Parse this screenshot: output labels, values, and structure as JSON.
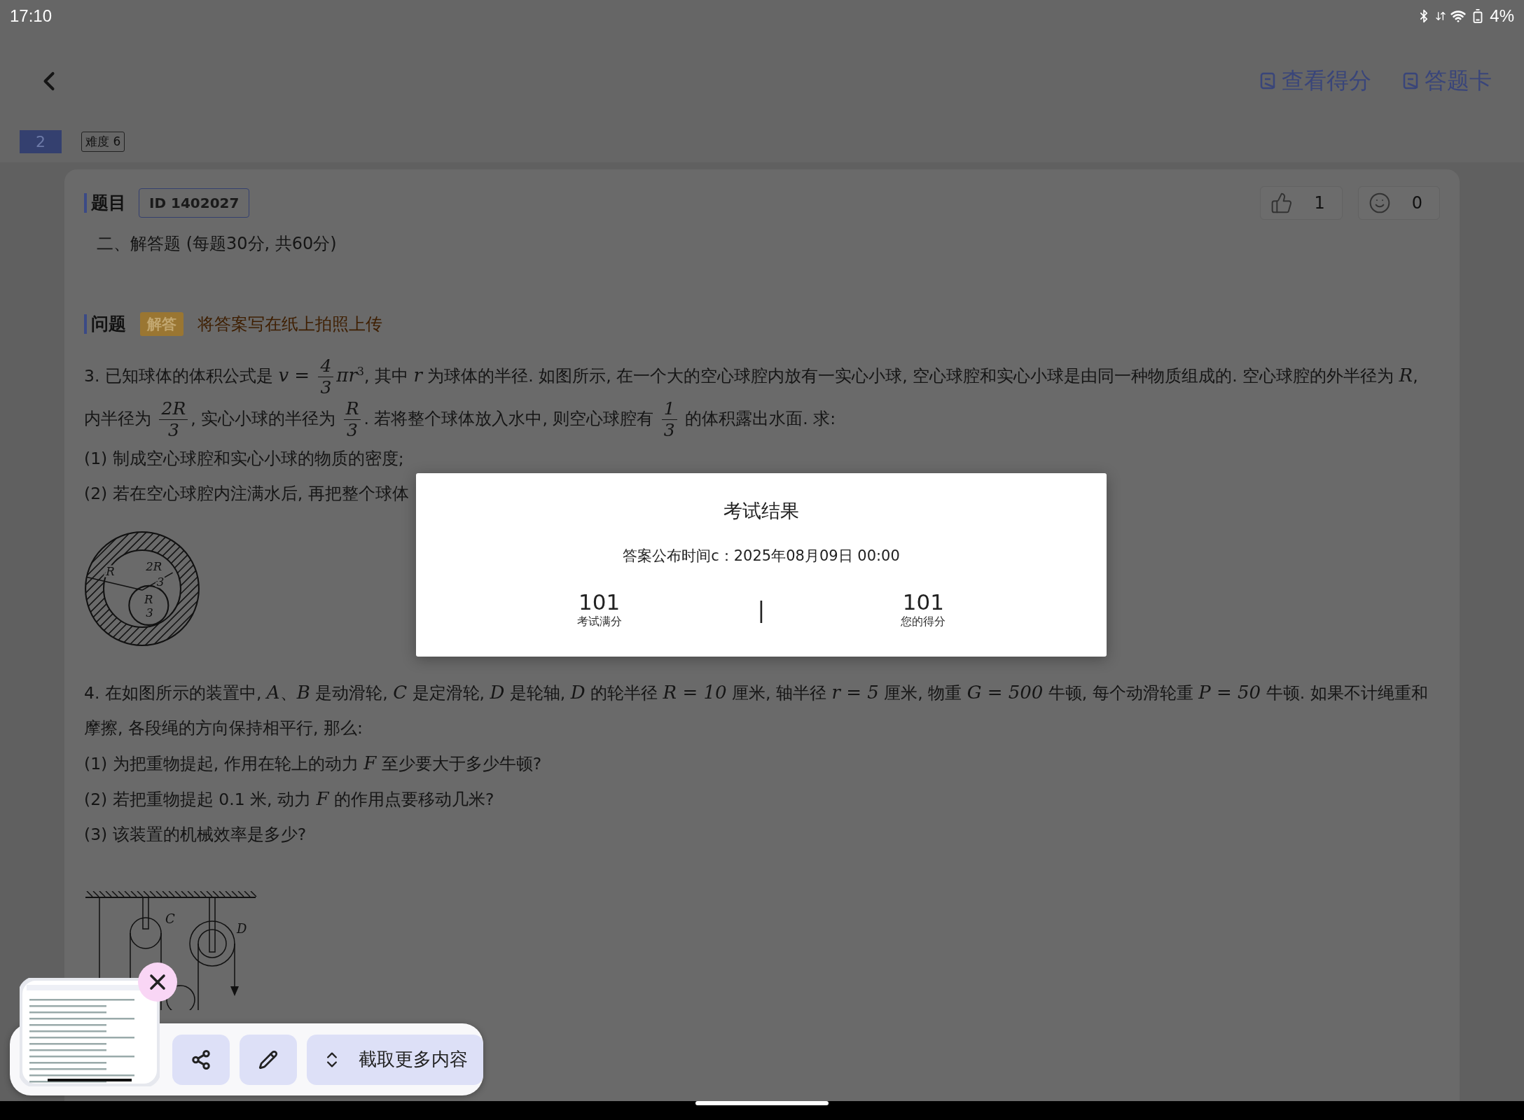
{
  "status_bar": {
    "time": "17:10",
    "battery": "4%"
  },
  "header": {
    "links": [
      {
        "label": "查看得分"
      },
      {
        "label": "答题卡"
      }
    ]
  },
  "question_tags": {
    "number": "2",
    "difficulty": "难度 6"
  },
  "card": {
    "section_title": "题目",
    "id_badge": "ID 1402027",
    "reactions": [
      {
        "kind": "like",
        "count": "1"
      },
      {
        "kind": "smile",
        "count": "0"
      }
    ],
    "subtitle": "二、解答题 (每题30分, 共60分)",
    "question_title": "问题",
    "type_badge": "解答",
    "hint": "将答案写在纸上拍照上传",
    "questions": [
      {
        "paragraphs": [
          [
            {
              "kind": "text",
              "t": "3. 已知球体的体积公式是 "
            },
            {
              "kind": "math",
              "t": "v = "
            },
            {
              "kind": "frac",
              "num": "4",
              "den": "3"
            },
            {
              "kind": "math",
              "t": "πr"
            },
            {
              "kind": "sup",
              "t": "3"
            },
            {
              "kind": "text",
              "t": ", 其中 "
            },
            {
              "kind": "math",
              "t": "r"
            },
            {
              "kind": "text",
              "t": " 为球体的半径. 如图所示, 在一个大的空心球腔内放有一实心小球, 空心球腔和实心小球是由同一种物质组成的. 空心球腔的外半径为 "
            },
            {
              "kind": "math",
              "t": "R"
            },
            {
              "kind": "text",
              "t": ", 内半径为 "
            },
            {
              "kind": "frac",
              "num": "2R",
              "den": "3"
            },
            {
              "kind": "text",
              "t": ", 实心小球的半径为 "
            },
            {
              "kind": "frac",
              "num": "R",
              "den": "3"
            },
            {
              "kind": "text",
              "t": ". 若将整个球体放入水中, 则空心球腔有 "
            },
            {
              "kind": "frac",
              "num": "1",
              "den": "3"
            },
            {
              "kind": "text",
              "t": " 的体积露出水面. 求:"
            }
          ],
          [
            {
              "kind": "text",
              "t": "(1) 制成空心球腔和实心小球的物质的密度;"
            }
          ],
          [
            {
              "kind": "text",
              "t": "(2) 若在空心球腔内注满水后, 再把整个球体"
            }
          ]
        ],
        "figure": {
          "kind": "spheres",
          "labels": [
            "R",
            "2R",
            "3",
            "R",
            "3"
          ]
        }
      },
      {
        "paragraphs": [
          [
            {
              "kind": "text",
              "t": "4. 在如图所示的装置中, "
            },
            {
              "kind": "math",
              "t": "A"
            },
            {
              "kind": "text",
              "t": "、"
            },
            {
              "kind": "math",
              "t": "B"
            },
            {
              "kind": "text",
              "t": " 是动滑轮, "
            },
            {
              "kind": "math",
              "t": "C"
            },
            {
              "kind": "text",
              "t": " 是定滑轮, "
            },
            {
              "kind": "math",
              "t": "D"
            },
            {
              "kind": "text",
              "t": " 是轮轴, "
            },
            {
              "kind": "math",
              "t": "D"
            },
            {
              "kind": "text",
              "t": " 的轮半径 "
            },
            {
              "kind": "math",
              "t": "R = 10"
            },
            {
              "kind": "text",
              "t": " 厘米, 轴半径 "
            },
            {
              "kind": "math",
              "t": "r = 5"
            },
            {
              "kind": "text",
              "t": " 厘米, 物重 "
            },
            {
              "kind": "math",
              "t": "G = 500"
            },
            {
              "kind": "text",
              "t": " 牛顿, 每个动滑轮重 "
            },
            {
              "kind": "math",
              "t": "P = 50"
            },
            {
              "kind": "text",
              "t": " 牛顿. 如果不计绳重和摩擦, 各段绳的方向保持相平行, 那么:"
            }
          ],
          [
            {
              "kind": "text",
              "t": "(1) 为把重物提起, 作用在轮上的动力 "
            },
            {
              "kind": "math",
              "t": "F"
            },
            {
              "kind": "text",
              "t": " 至少要大于多少牛顿?"
            }
          ],
          [
            {
              "kind": "text",
              "t": "(2) 若把重物提起 0.1 米, 动力 "
            },
            {
              "kind": "math",
              "t": "F"
            },
            {
              "kind": "text",
              "t": " 的作用点要移动几米?"
            }
          ],
          [
            {
              "kind": "text",
              "t": "(3) 该装置的机械效率是多少?"
            }
          ]
        ],
        "figure": {
          "kind": "pulleys",
          "labels": [
            "C",
            "D"
          ]
        }
      }
    ]
  },
  "dialog": {
    "title": "考试结果",
    "release_time": "答案公布时间c：2025年08月09日 00:00",
    "stats": [
      {
        "value": "101",
        "label": "考试满分"
      },
      {
        "value": "101",
        "label": "您的得分"
      }
    ],
    "divider": "|"
  },
  "screenshot_toolbar": {
    "more_label": "截取更多内容"
  }
}
